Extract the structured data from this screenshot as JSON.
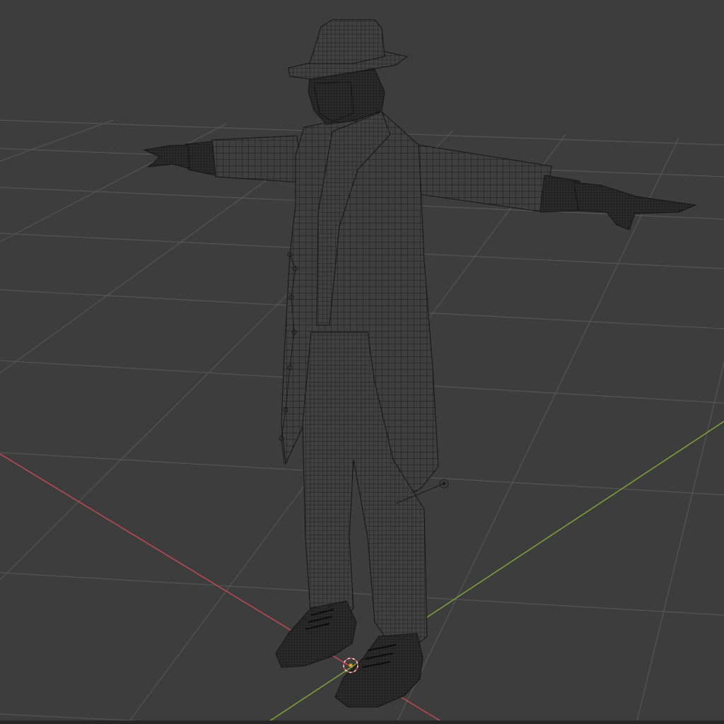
{
  "viewport": {
    "mode": "3d-wireframe",
    "background_color": "#3d3d3d",
    "grid_color": "#575757",
    "x_axis_color": "#c04a52",
    "y_axis_color": "#7da63a",
    "wire_color": "#1a1a1a",
    "silhouette_fill": "#3f3f3f"
  },
  "scene": {
    "object": "character-mesh-t-pose",
    "object_icon": "person-wireframe-icon",
    "origin_icon": "3d-cursor-icon",
    "light_icon": "light-empty-icon"
  }
}
